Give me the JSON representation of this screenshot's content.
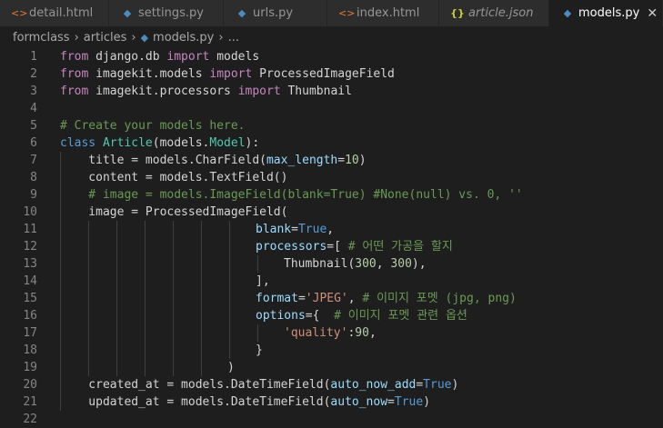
{
  "tabs": [
    {
      "label": "detail.html",
      "icon": "html-icon",
      "active": false
    },
    {
      "label": "settings.py",
      "icon": "python-icon",
      "active": false
    },
    {
      "label": "urls.py",
      "icon": "python-icon",
      "active": false
    },
    {
      "label": "index.html",
      "icon": "html-icon",
      "active": false
    },
    {
      "label": "article.json",
      "icon": "json-icon",
      "active": false
    },
    {
      "label": "models.py",
      "icon": "python-icon",
      "active": true
    }
  ],
  "breadcrumb": {
    "folder1": "formclass",
    "folder2": "articles",
    "file": "models.py",
    "symbol": "..."
  },
  "lines": [
    {
      "num": "1"
    },
    {
      "num": "2"
    },
    {
      "num": "3"
    },
    {
      "num": "4"
    },
    {
      "num": "5"
    },
    {
      "num": "6"
    },
    {
      "num": "7"
    },
    {
      "num": "8"
    },
    {
      "num": "9"
    },
    {
      "num": "10"
    },
    {
      "num": "11"
    },
    {
      "num": "12"
    },
    {
      "num": "13"
    },
    {
      "num": "14"
    },
    {
      "num": "15"
    },
    {
      "num": "16"
    },
    {
      "num": "17"
    },
    {
      "num": "18"
    },
    {
      "num": "19"
    },
    {
      "num": "20"
    },
    {
      "num": "21"
    },
    {
      "num": "22"
    }
  ],
  "code": {
    "l1": [
      "from",
      " django.db ",
      "import",
      " models"
    ],
    "l2": [
      "from",
      " imagekit.models ",
      "import",
      " ProcessedImageField"
    ],
    "l3": [
      "from",
      " imagekit.processors ",
      "import",
      " Thumbnail"
    ],
    "l5": "# Create your models here.",
    "l6": [
      "class",
      " ",
      "Article",
      "(models.",
      "Model",
      "):"
    ],
    "l7": [
      "    title = models.CharField(",
      "max_length",
      "=",
      "10",
      ")"
    ],
    "l8": "    content = models.TextField()",
    "l9": "    # image = models.ImageField(blank=True) #None(null) vs. 0, ''",
    "l10": "    image = ProcessedImageField(",
    "l11": [
      "blank",
      "=",
      "True",
      ","
    ],
    "l12": [
      "processors",
      "=[ ",
      "# 어떤 가공을 할지"
    ],
    "l13": [
      "Thumbnail(",
      "300",
      ", ",
      "300",
      "),"
    ],
    "l14": "],",
    "l15": [
      "format",
      "=",
      "'JPEG'",
      ", ",
      "# 이미지 포멧 (jpg, png)"
    ],
    "l16": [
      "options",
      "={  ",
      "# 이미지 포멧 관련 옵션"
    ],
    "l17": [
      "'quality'",
      ":",
      "90",
      ","
    ],
    "l18": "}",
    "l19": ")",
    "l20": [
      "    created_at = models.DateTimeField(",
      "auto_now_add",
      "=",
      "True",
      ")"
    ],
    "l21": [
      "    updated_at = models.DateTimeField(",
      "auto_now",
      "=",
      "True",
      ")"
    ]
  },
  "colors": {
    "background": "#1e1e1e",
    "keyword": "#c586c0",
    "class_keyword": "#569cd6",
    "class_name": "#4ec9b0",
    "parameter": "#9cdcfe",
    "number": "#b5cea8",
    "string": "#ce9178",
    "comment": "#6a9955"
  }
}
